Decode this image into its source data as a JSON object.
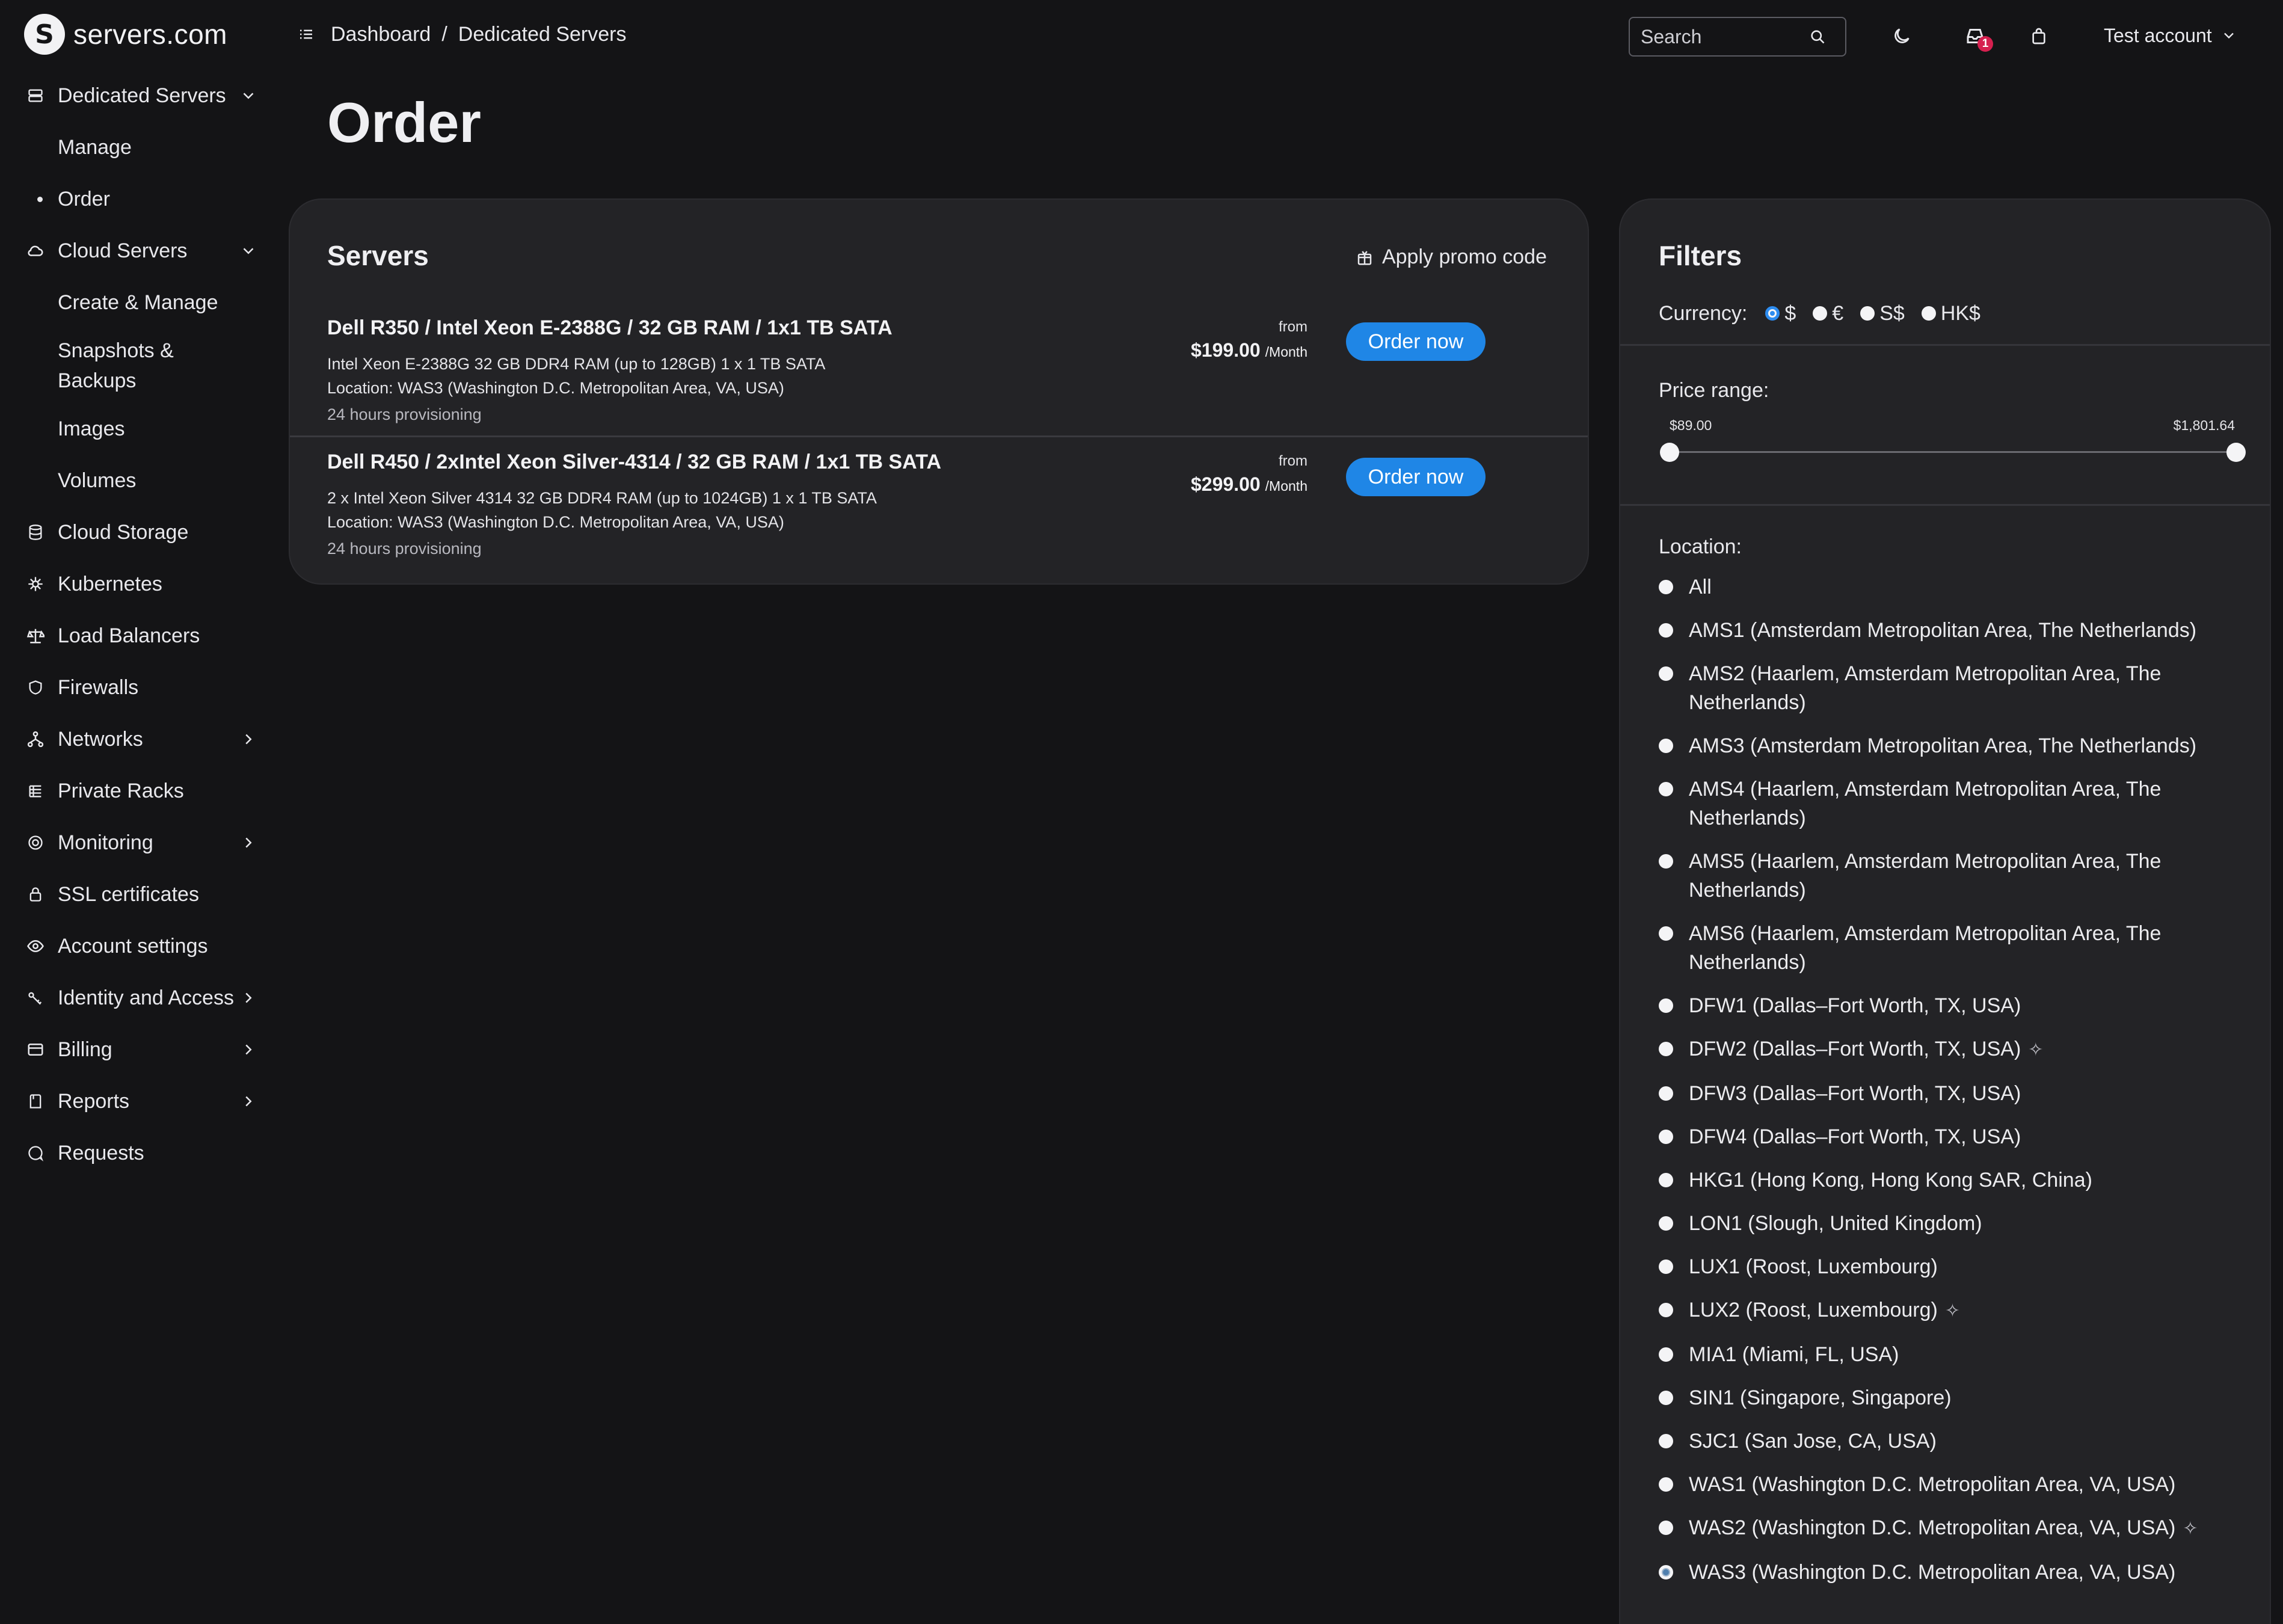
{
  "brand": {
    "name": "servers.com",
    "mark": "S"
  },
  "sidebar": {
    "items": [
      {
        "label": "Dedicated Servers",
        "icon": "server-icon",
        "chevron": "down"
      },
      {
        "label": "Manage",
        "sub": true
      },
      {
        "label": "Order",
        "sub": true,
        "active": true
      },
      {
        "label": "Cloud Servers",
        "icon": "cloud-icon",
        "chevron": "down"
      },
      {
        "label": "Create & Manage",
        "sub": true
      },
      {
        "label": "Snapshots & Backups",
        "sub": true
      },
      {
        "label": "Images",
        "sub": true
      },
      {
        "label": "Volumes",
        "sub": true
      },
      {
        "label": "Cloud Storage",
        "icon": "database-icon"
      },
      {
        "label": "Kubernetes",
        "icon": "helm-icon"
      },
      {
        "label": "Load Balancers",
        "icon": "balance-icon"
      },
      {
        "label": "Firewalls",
        "icon": "shield-icon"
      },
      {
        "label": "Networks",
        "icon": "network-icon",
        "chevron": "right"
      },
      {
        "label": "Private Racks",
        "icon": "rack-icon"
      },
      {
        "label": "Monitoring",
        "icon": "monitor-icon",
        "chevron": "right"
      },
      {
        "label": "SSL certificates",
        "icon": "lock-icon"
      },
      {
        "label": "Account settings",
        "icon": "eye-icon"
      },
      {
        "label": "Identity and Access",
        "icon": "key-icon",
        "chevron": "right"
      },
      {
        "label": "Billing",
        "icon": "card-icon",
        "chevron": "right"
      },
      {
        "label": "Reports",
        "icon": "report-icon",
        "chevron": "right"
      },
      {
        "label": "Requests",
        "icon": "chat-icon"
      }
    ]
  },
  "topbar": {
    "breadcrumb": [
      "Dashboard",
      "/",
      "Dedicated Servers"
    ],
    "search_placeholder": "Search",
    "notifications_count": "1",
    "account_label": "Test account"
  },
  "page": {
    "title": "Order"
  },
  "servers": {
    "title": "Servers",
    "promo_label": "Apply promo code",
    "items": [
      {
        "name": "Dell R350 / Intel Xeon E-2388G / 32 GB RAM / 1x1 TB SATA",
        "spec": "Intel Xeon E-2388G 32 GB DDR4 RAM (up to 128GB) 1 x 1 TB SATA",
        "location": "Location: WAS3 (Washington D.C. Metropolitan Area, VA, USA)",
        "provisioning": "24 hours provisioning",
        "from": "from",
        "price": "$199.00",
        "period": "/Month",
        "button": "Order now"
      },
      {
        "name": "Dell R450 / 2xIntel Xeon Silver-4314 / 32 GB RAM / 1x1 TB SATA",
        "spec": "2 x Intel Xeon Silver 4314 32 GB DDR4 RAM (up to 1024GB) 1 x 1 TB SATA",
        "location": "Location: WAS3 (Washington D.C. Metropolitan Area, VA, USA)",
        "provisioning": "24 hours provisioning",
        "from": "from",
        "price": "$299.00",
        "period": "/Month",
        "button": "Order now"
      }
    ]
  },
  "filters": {
    "title": "Filters",
    "currency_label": "Currency:",
    "currencies": [
      "$",
      "€",
      "S$",
      "HK$"
    ],
    "currency_selected": "$",
    "price_label": "Price range:",
    "price_min": "$89.00",
    "price_max": "$1,801.64",
    "location_label": "Location:",
    "locations": [
      {
        "label": "All"
      },
      {
        "label": "AMS1 (Amsterdam Metropolitan Area, The Netherlands)"
      },
      {
        "label": "AMS2 (Haarlem, Amsterdam Metropolitan Area, The Netherlands)"
      },
      {
        "label": "AMS3 (Amsterdam Metropolitan Area, The Netherlands)"
      },
      {
        "label": "AMS4 (Haarlem, Amsterdam Metropolitan Area, The Netherlands)"
      },
      {
        "label": "AMS5 (Haarlem, Amsterdam Metropolitan Area, The Netherlands)"
      },
      {
        "label": "AMS6 (Haarlem, Amsterdam Metropolitan Area, The Netherlands)"
      },
      {
        "label": "DFW1 (Dallas–Fort Worth, TX, USA)"
      },
      {
        "label": "DFW2 (Dallas–Fort Worth, TX, USA)",
        "tag": true
      },
      {
        "label": "DFW3 (Dallas–Fort Worth, TX, USA)"
      },
      {
        "label": "DFW4 (Dallas–Fort Worth, TX, USA)"
      },
      {
        "label": "HKG1 (Hong Kong, Hong Kong SAR, China)"
      },
      {
        "label": "LON1 (Slough, United Kingdom)"
      },
      {
        "label": "LUX1 (Roost, Luxembourg)"
      },
      {
        "label": "LUX2 (Roost, Luxembourg)",
        "tag": true
      },
      {
        "label": "MIA1 (Miami, FL, USA)"
      },
      {
        "label": "SIN1 (Singapore, Singapore)"
      },
      {
        "label": "SJC1 (San Jose, CA, USA)"
      },
      {
        "label": "WAS1 (Washington D.C. Metropolitan Area, VA, USA)"
      },
      {
        "label": "WAS2 (Washington D.C. Metropolitan Area, VA, USA)",
        "tag": true
      },
      {
        "label": "WAS3 (Washington D.C. Metropolitan Area, VA, USA)",
        "selected": true
      }
    ]
  },
  "colors": {
    "accent": "#1f86e6",
    "badge": "#d6204f",
    "card": "#232326",
    "background": "#141416"
  }
}
